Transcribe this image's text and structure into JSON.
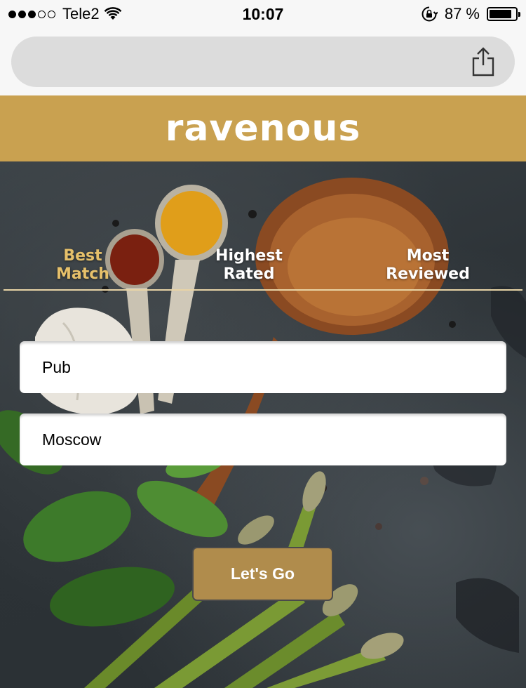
{
  "status_bar": {
    "signal_dots_filled": 3,
    "signal_dots_total": 5,
    "carrier": "Tele2",
    "time": "10:07",
    "battery_text": "87 %",
    "battery_level": 0.87,
    "icons": [
      "wifi-icon",
      "rotation-lock-icon",
      "battery-icon"
    ]
  },
  "browser": {
    "url": "",
    "share_icon": "share-icon"
  },
  "header": {
    "title": "ravenous",
    "color": "#c9a150"
  },
  "sort_tabs": [
    {
      "line1": "Best",
      "line2": "Match",
      "active": true
    },
    {
      "line1": "Highest",
      "line2": "Rated",
      "active": false
    },
    {
      "line1": "Most",
      "line2": "Reviewed",
      "active": false
    }
  ],
  "search": {
    "term_value": "Pub",
    "location_value": "Moscow"
  },
  "submit": {
    "label": "Let's Go",
    "color": "#b08c4c"
  },
  "colors": {
    "accent": "#c9a150",
    "active_tab": "#e6c06a"
  }
}
